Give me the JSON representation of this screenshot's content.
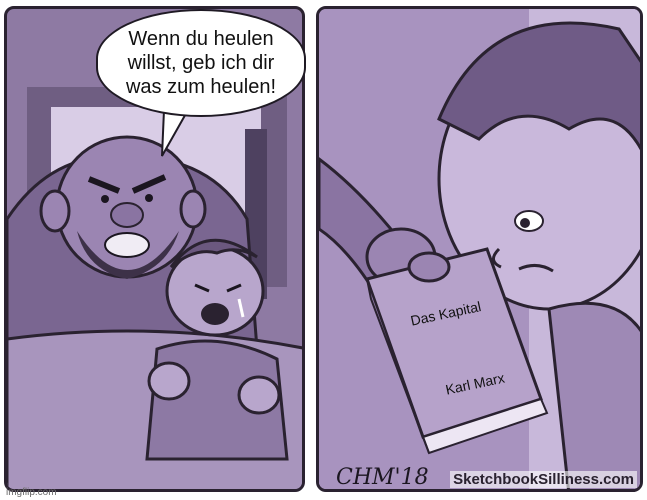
{
  "speech_bubble": {
    "text": "Wenn du heulen\nwillst, geb ich dir\nwas zum heulen!"
  },
  "book": {
    "title": "Das Kapital",
    "author": "Karl Marx"
  },
  "watermark": {
    "site": "SketchbookSilliness.com",
    "imgflip": "imgflip.com"
  },
  "signature": "CHM'18",
  "colors": {
    "panel_left": "#8e7aa3",
    "panel_right": "#b9a6cc",
    "outline": "#2a2230"
  }
}
